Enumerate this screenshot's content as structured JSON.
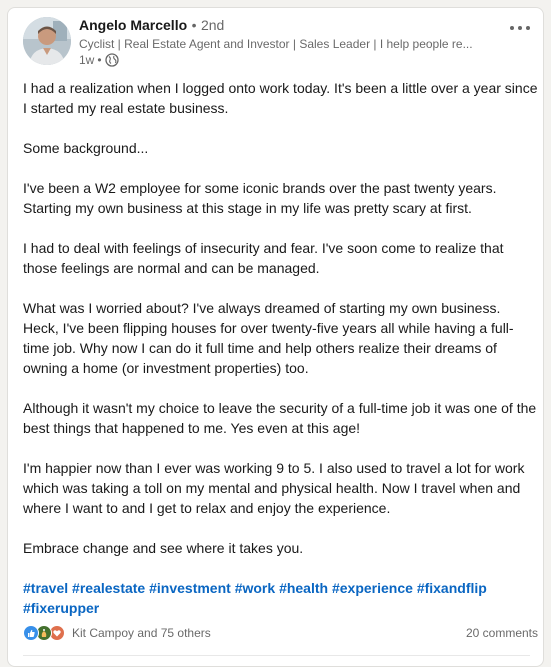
{
  "author": {
    "name": "Angelo Marcello",
    "separator": "•",
    "degree": "2nd",
    "headline": "Cyclist | Real Estate Agent and Investor | Sales Leader | I help people re...",
    "time": "1w",
    "meta_separator": "•",
    "visibility_icon": "globe-icon",
    "avatar_icon": "avatar-photo"
  },
  "post": {
    "paragraphs": [
      "I had a realization when I logged onto work today. It's been a little over a year since I started my real estate business.",
      "Some background...",
      "I've been a W2 employee for some iconic brands over the past twenty years. Starting my own business at this stage in my life was pretty scary at first.",
      "I had to deal with feelings of insecurity and fear. I've soon come to realize that those feelings are normal and can be managed.",
      "What was I worried about? I've always dreamed of starting my own business. Heck, I've been flipping houses for over twenty-five years all while having a full-time job. Why now I can do it full time and help others realize their dreams of owning a home (or investment properties) too.",
      "Although it wasn't my choice to leave the security of a full-time job it was one of the best things that happened to me. Yes even at this age!",
      "I'm happier now than I ever was working 9 to 5. I also used to travel a lot for work which was taking a toll on my mental and physical health. Now I travel when and where I want to and I get to relax and enjoy the experience.",
      "Embrace change and see where it takes you."
    ],
    "hashtags": [
      "#travel",
      "#realestate",
      "#investment",
      "#work",
      "#health",
      "#experience",
      "#fixandflip",
      "#fixerupper"
    ]
  },
  "social": {
    "reaction_icons": [
      "like-icon",
      "celebrate-icon",
      "love-icon"
    ],
    "reactors": "Kit Campoy and 75 others",
    "comments": "20 comments"
  },
  "colors": {
    "link": "#0a66c2",
    "like": "#378fe9",
    "celebrate": "#44712e",
    "love": "#df704d",
    "background": "#f3f2ef"
  }
}
